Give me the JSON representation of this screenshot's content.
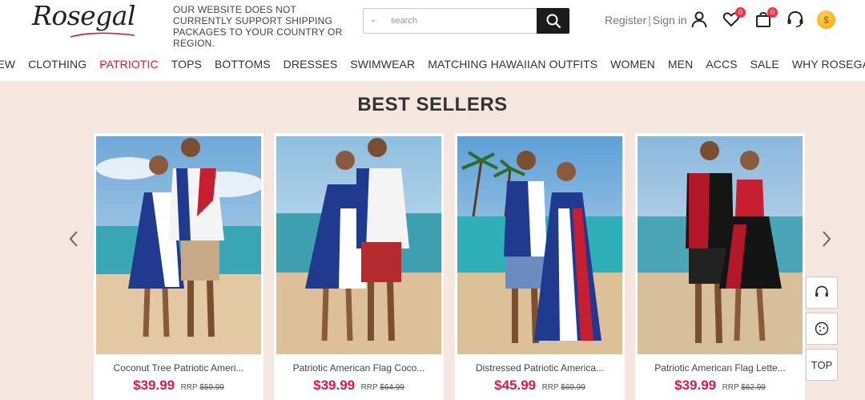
{
  "header": {
    "logo_text": "Rosegal",
    "shipping_notice": "OUR WEBSITE DOES NOT CURRENTLY SUPPORT SHIPPING PACKAGES TO YOUR COUNTRY OR REGION.",
    "search": {
      "placeholder": "search",
      "value": ""
    },
    "register_label": "Register",
    "separator": "|",
    "signin_label": "Sign in",
    "wishlist_count": "0",
    "cart_count": "0",
    "icons": [
      "user-icon",
      "heart-icon",
      "bag-icon",
      "headset-icon",
      "coin-icon"
    ]
  },
  "nav": {
    "items": [
      {
        "label": "NEW"
      },
      {
        "label": "CLOTHING"
      },
      {
        "label": "PATRIOTIC"
      },
      {
        "label": "TOPS"
      },
      {
        "label": "BOTTOMS"
      },
      {
        "label": "DRESSES"
      },
      {
        "label": "SWIMWEAR"
      },
      {
        "label": "MATCHING HAWAIIAN OUTFITS"
      },
      {
        "label": "WOMEN"
      },
      {
        "label": "MEN"
      },
      {
        "label": "ACCS"
      },
      {
        "label": "SALE"
      },
      {
        "label": "WHY ROSEGAL"
      }
    ],
    "active_index": 2
  },
  "section": {
    "title": "BEST SELLERS"
  },
  "products": [
    {
      "name": "Coconut Tree Patriotic Ameri...",
      "price": "$39.99",
      "rrp_label": "RRP",
      "rrp": "$59.99"
    },
    {
      "name": "Patriotic American Flag Coco...",
      "price": "$39.99",
      "rrp_label": "RRP",
      "rrp": "$64.99"
    },
    {
      "name": "Distressed Patriotic America...",
      "price": "$45.99",
      "rrp_label": "RRP",
      "rrp": "$69.99"
    },
    {
      "name": "Patriotic American Flag Lette...",
      "price": "$39.99",
      "rrp_label": "RRP",
      "rrp": "$62.99"
    }
  ],
  "floating": {
    "top_label": "TOP"
  },
  "colors": {
    "accent_red": "#e0182d",
    "price_pink": "#e0184f",
    "section_bg": "#f5e6e0"
  }
}
